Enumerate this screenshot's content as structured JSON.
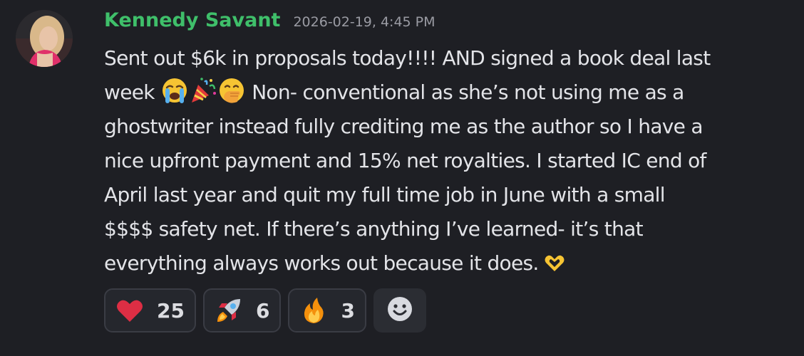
{
  "message": {
    "author": "Kennedy Savant",
    "timestamp": "2026-02-19, 4:45 PM",
    "lines": [
      "Sent out $6k in proposals today!!!! AND signed a book deal last",
      "Non- conventional as she’s not using me as a",
      "ghostwriter instead fully crediting me as the author so I have a",
      "nice upfront payment and 15% net royalties. I started IC end of",
      "April last year and quit my full time job in June with a small",
      "$$$$ safety net. If there’s anything I’ve learned- it’s that",
      "everything always works out because it does."
    ],
    "line2_prefix": "week",
    "inline_emojis": [
      "crying-face-emoji",
      "party-popper-emoji",
      "hand-over-mouth-emoji",
      "heart-hands-emoji"
    ]
  },
  "reactions": [
    {
      "icon": "red-heart-emoji",
      "count": "25"
    },
    {
      "icon": "rocket-emoji",
      "count": "6"
    },
    {
      "icon": "fire-emoji",
      "count": "3"
    }
  ],
  "add_reaction": {
    "icon": "smiley-add-reaction-icon"
  },
  "colors": {
    "background": "#1e1f24",
    "username": "#3fbf6a",
    "timestamp": "#9a9ba3",
    "text": "#e3e4e8",
    "reaction_bg": "#25272d",
    "reaction_border": "#3a3c44"
  }
}
